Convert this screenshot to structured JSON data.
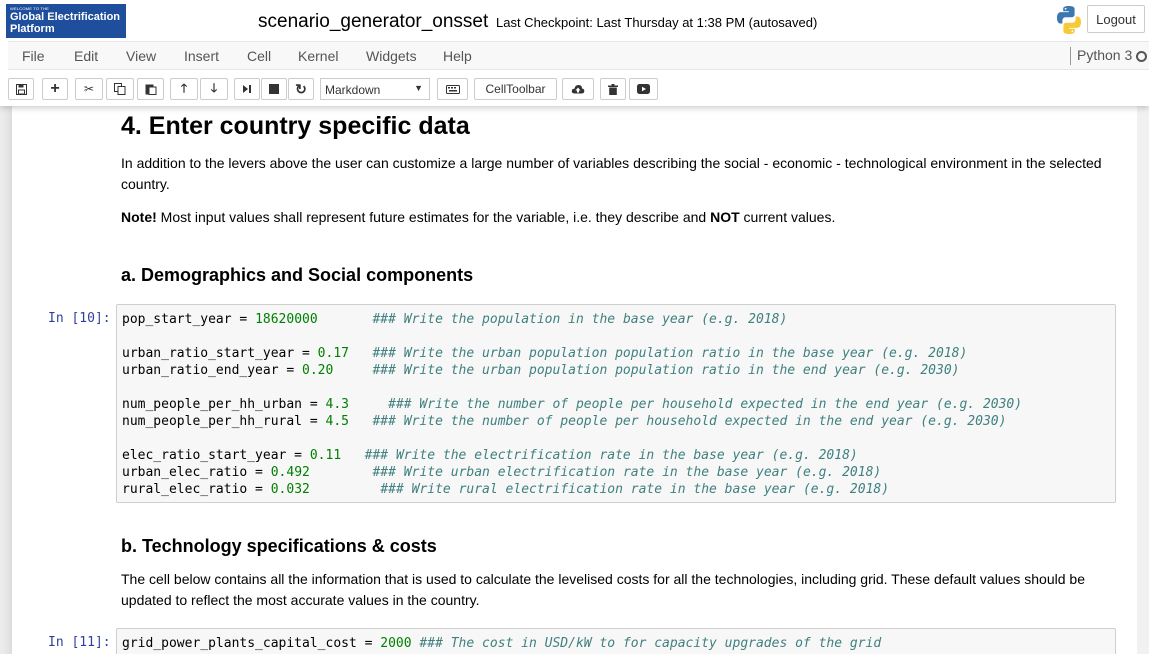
{
  "header": {
    "logo_small": "WELCOME TO THE",
    "logo_line1": "Global Electrification",
    "logo_line2": "Platform",
    "notebook_name": "scenario_generator_onsset",
    "checkpoint": "Last Checkpoint: Last Thursday at 1:38 PM (autosaved)",
    "logout": "Logout"
  },
  "menu": [
    "File",
    "Edit",
    "View",
    "Insert",
    "Cell",
    "Kernel",
    "Widgets",
    "Help"
  ],
  "kernel": "Python 3",
  "toolbar": {
    "cell_type": "Markdown",
    "celltoolbar": "CellToolbar"
  },
  "content": {
    "h1": "4. Enter country specific data",
    "p1": "In addition to the levers above the user can customize a large number of variables describing the social - economic - technological environment in the selected country.",
    "note_bold": "Note!",
    "note_text1": " Most input values shall represent future estimates for the variable, i.e. they describe and ",
    "note_not": "NOT",
    "note_text2": " current values.",
    "h3a": "a. Demographics and Social components",
    "prompt10": "In [10]:",
    "code10": [
      {
        "var": "pop_start_year",
        "op": " = ",
        "num": "18620000",
        "pad": "       ",
        "comment": "### Write the population in the base year (e.g. 2018)"
      },
      {
        "blank": true
      },
      {
        "var": "urban_ratio_start_year",
        "op": " = ",
        "num": "0.17",
        "pad": "   ",
        "comment": "### Write the urban population population ratio in the base year (e.g. 2018)"
      },
      {
        "var": "urban_ratio_end_year",
        "op": " = ",
        "num": "0.20",
        "pad": "     ",
        "comment": "### Write the urban population population ratio in the end year (e.g. 2030)"
      },
      {
        "blank": true
      },
      {
        "var": "num_people_per_hh_urban",
        "op": " = ",
        "num": "4.3",
        "pad": "     ",
        "comment": "### Write the number of people per household expected in the end year (e.g. 2030)"
      },
      {
        "var": "num_people_per_hh_rural",
        "op": " = ",
        "num": "4.5",
        "pad": "   ",
        "comment": "### Write the number of people per household expected in the end year (e.g. 2030)"
      },
      {
        "blank": true
      },
      {
        "var": "elec_ratio_start_year",
        "op": " = ",
        "num": "0.11",
        "pad": "   ",
        "comment": "### Write the electrification rate in the base year (e.g. 2018)"
      },
      {
        "var": "urban_elec_ratio",
        "op": " = ",
        "num": "0.492",
        "pad": "        ",
        "comment": "### Write urban electrification rate in the base year (e.g. 2018)"
      },
      {
        "var": "rural_elec_ratio",
        "op": " = ",
        "num": "0.032",
        "pad": "         ",
        "comment": "### Write rural electrification rate in the base year (e.g. 2018)"
      }
    ],
    "h3b": "b. Technology specifications & costs",
    "p2": "The cell below contains all the information that is used to calculate the levelised costs for all the technologies, including grid. These default values should be updated to reflect the most accurate values in the country.",
    "prompt11": "In [11]:",
    "code11": [
      {
        "var": "grid_power_plants_capital_cost",
        "op": " = ",
        "num": "2000",
        "pad": " ",
        "comment": "### The cost in USD/kW to for capacity upgrades of the grid"
      }
    ]
  }
}
